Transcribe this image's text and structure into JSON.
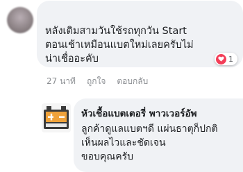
{
  "comment": {
    "text": "หลังเติมสามวันใช้รถทุกวัน Start\nตอนเช้าเหมือนแบตใหม่เลยครับไม่\nน่าเชื่ออะคับ",
    "reaction_count": "1",
    "reaction_icon": "heart-icon",
    "timestamp": "27 นาที",
    "like_label": "ถูกใจ",
    "reply_label": "ตอบกลับ"
  },
  "reply": {
    "author": "หัวเชื้อแบตเตอรี่ พาวเวอร์อัพ",
    "text": "ลูกค้าดูแลแบตฯดี แผ่นธาตุก็ปกติ\nเห็นผลไวและชัดเจน\nขอบคุณครับ"
  },
  "colors": {
    "bubble": "#f0f2f5",
    "meta_text": "#8a8d91",
    "heart": "#f33e58",
    "logo_orange": "#f0a23a",
    "logo_dark": "#3b3b3b"
  }
}
